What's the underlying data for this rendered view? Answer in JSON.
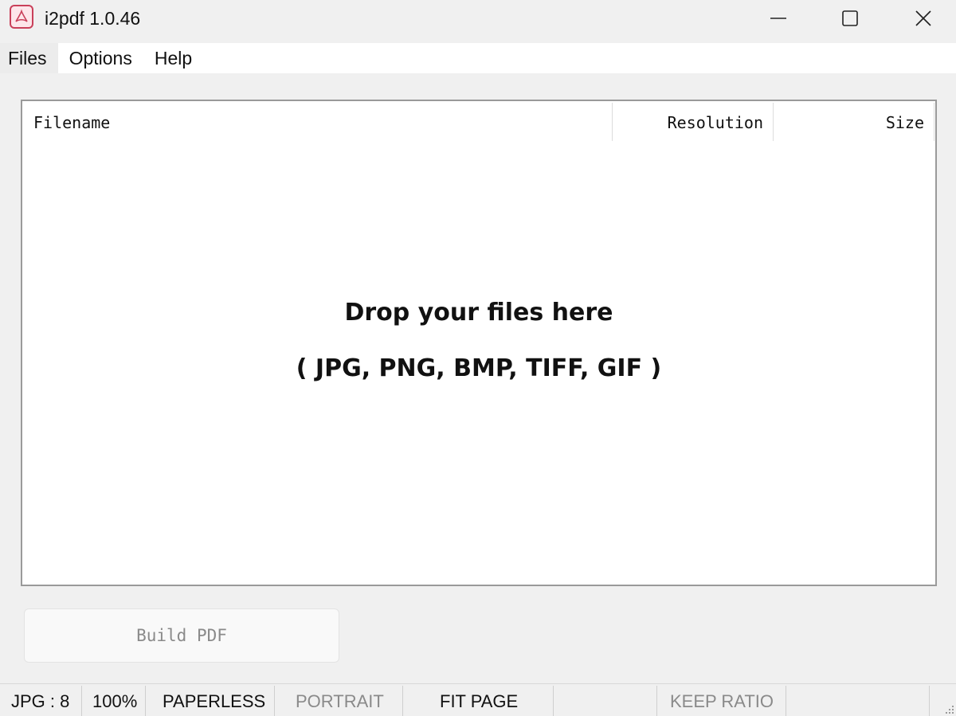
{
  "window": {
    "title": "i2pdf 1.0.46"
  },
  "menu": {
    "items": [
      "Files",
      "Options",
      "Help"
    ]
  },
  "file_list": {
    "columns": [
      "Filename",
      "Resolution",
      "Size"
    ],
    "drop_message": "Drop your files here",
    "drop_formats": "( JPG, PNG, BMP, TIFF, GIF )"
  },
  "actions": {
    "build_label": "Build PDF"
  },
  "status": {
    "format": "JPG : 8",
    "quality": "100%",
    "paper": "PAPERLESS",
    "orientation": "PORTRAIT",
    "fit": "FIT PAGE",
    "ratio": "KEEP RATIO"
  },
  "icons": {
    "app": "pdf-app-icon",
    "minimize": "minimize-icon",
    "maximize": "maximize-icon",
    "close": "close-icon"
  },
  "colors": {
    "accent": "#c9405a",
    "disabled_text": "#8a8a8a"
  }
}
